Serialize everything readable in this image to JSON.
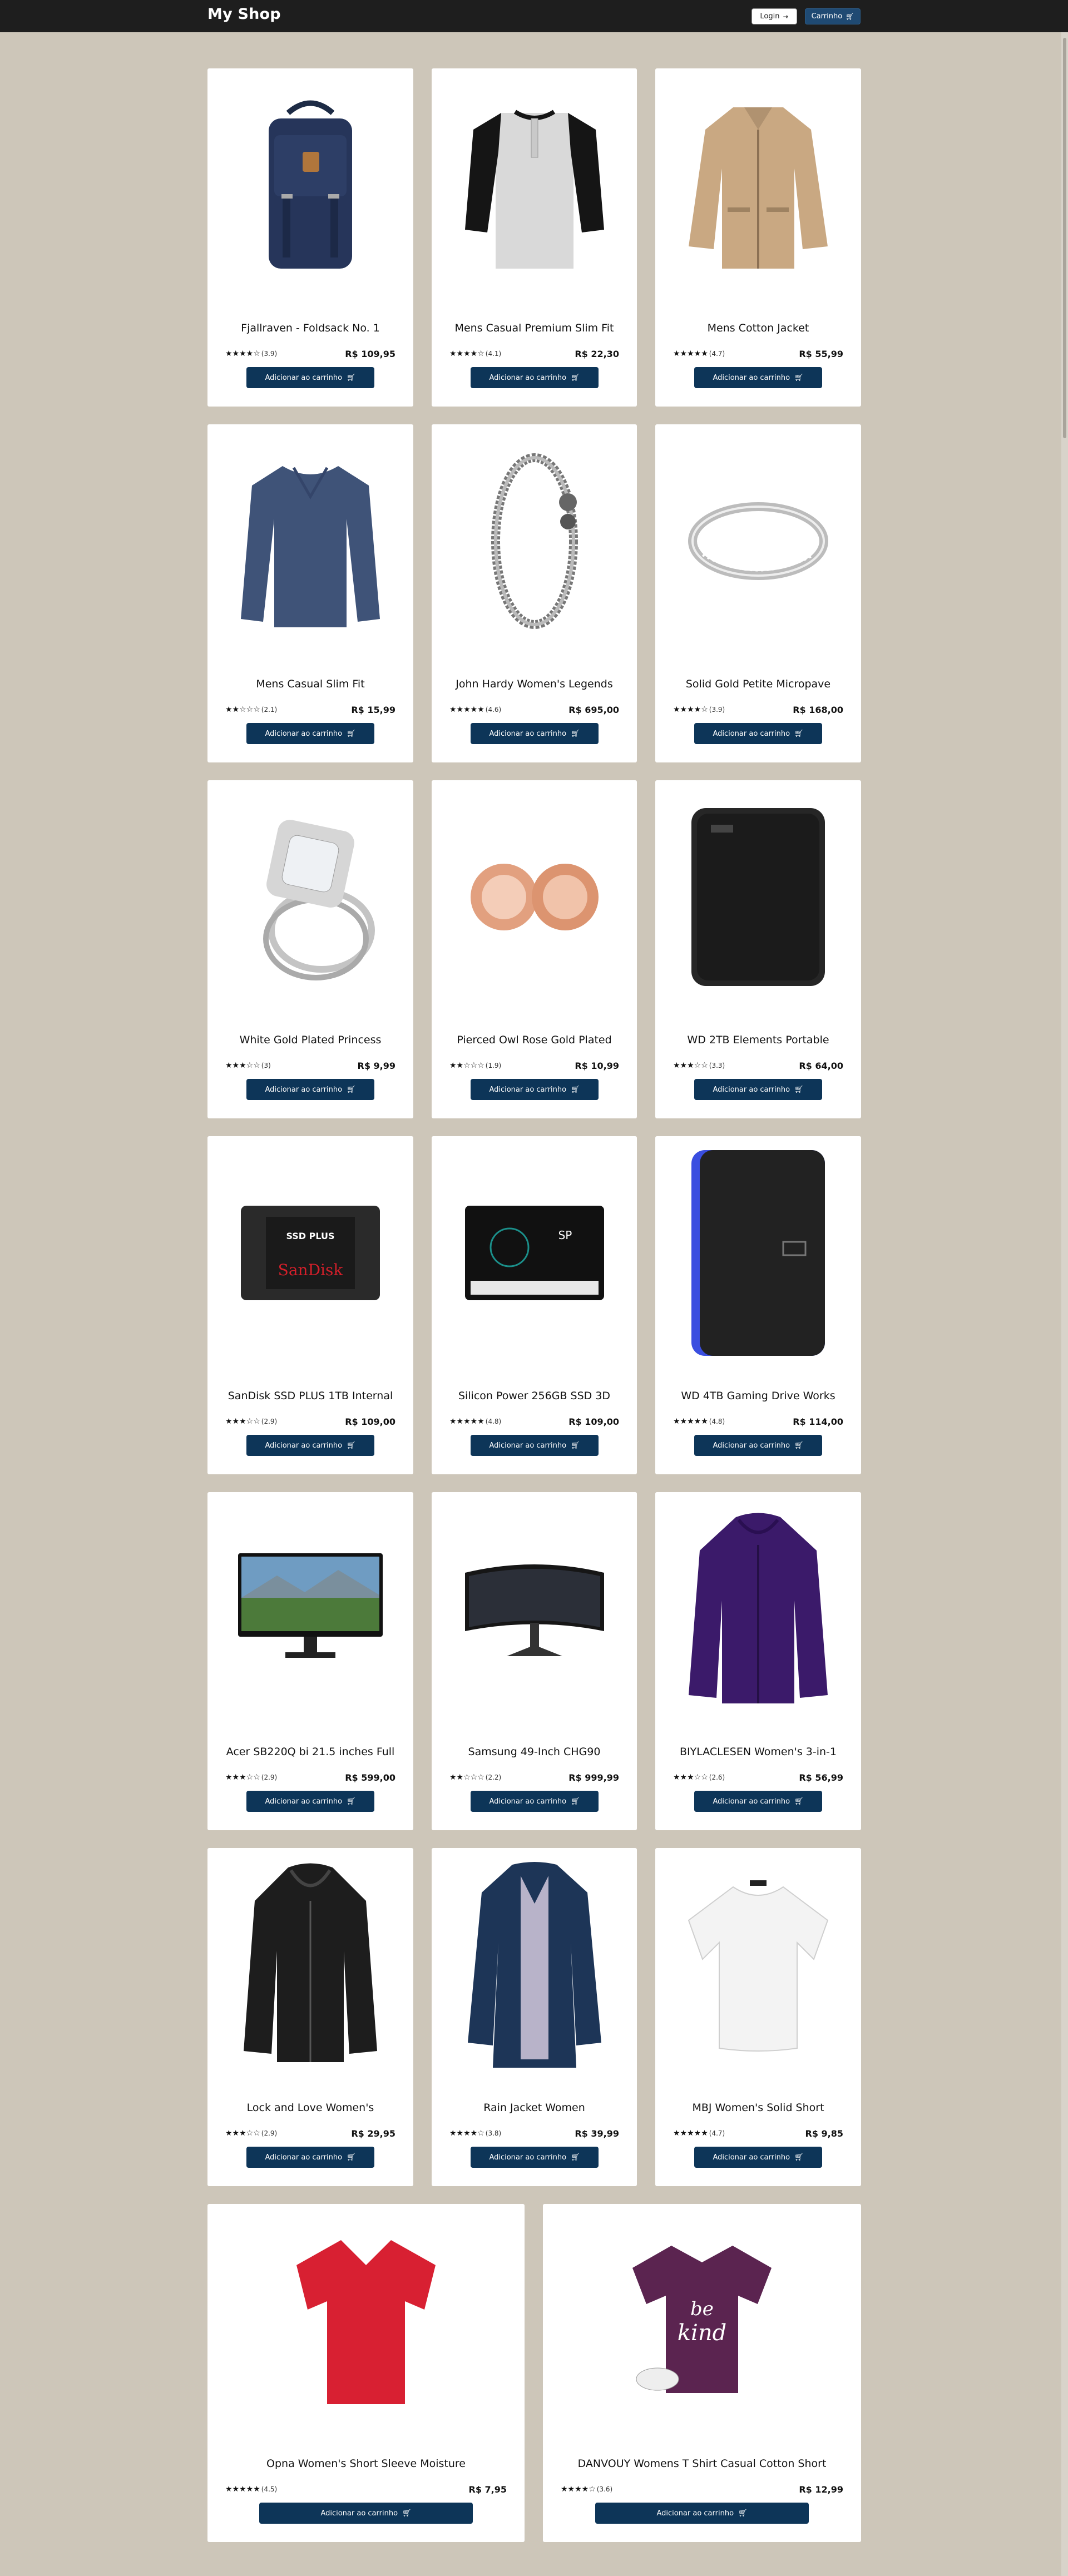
{
  "header": {
    "logo": "My Shop",
    "login_label": "Login",
    "login_icon": "login-icon",
    "cart_label": "Carrinho",
    "cart_icon": "cart-icon"
  },
  "colors": {
    "header_bg": "#1e1e1e",
    "page_bg": "#cdc6b9",
    "button_bg": "#0d3558",
    "cart_button_bg": "#1f4a73"
  },
  "add_to_cart_label": "Adicionar ao carrinho",
  "products": [
    {
      "title": "Fjallraven - Foldsack No. 1",
      "rating": 4,
      "count": "(3.9)",
      "price": "R$ 109,95",
      "icon": "backpack-image"
    },
    {
      "title": "Mens Casual Premium Slim Fit",
      "rating": 4,
      "count": "(4.1)",
      "price": "R$ 22,30",
      "icon": "henley-shirt-image"
    },
    {
      "title": "Mens Cotton Jacket",
      "rating": 5,
      "count": "(4.7)",
      "price": "R$ 55,99",
      "icon": "cotton-jacket-image"
    },
    {
      "title": "Mens Casual Slim Fit",
      "rating": 2,
      "count": "(2.1)",
      "price": "R$ 15,99",
      "icon": "long-sleeve-shirt-image"
    },
    {
      "title": "John Hardy Women's Legends",
      "rating": 5,
      "count": "(4.6)",
      "price": "R$ 695,00",
      "icon": "bracelet-image"
    },
    {
      "title": "Solid Gold Petite Micropave",
      "rating": 4,
      "count": "(3.9)",
      "price": "R$ 168,00",
      "icon": "ring-image"
    },
    {
      "title": "White Gold Plated Princess",
      "rating": 3,
      "count": "(3)",
      "price": "R$ 9,99",
      "icon": "diamond-ring-image"
    },
    {
      "title": "Pierced Owl Rose Gold Plated",
      "rating": 2,
      "count": "(1.9)",
      "price": "R$ 10,99",
      "icon": "rose-gold-plugs-image"
    },
    {
      "title": "WD 2TB Elements Portable",
      "rating": 3,
      "count": "(3.3)",
      "price": "R$ 64,00",
      "icon": "black-hard-drive-image"
    },
    {
      "title": "SanDisk SSD PLUS 1TB Internal",
      "rating": 3,
      "count": "(2.9)",
      "price": "R$ 109,00",
      "icon": "sandisk-ssd-image"
    },
    {
      "title": "Silicon Power 256GB SSD 3D",
      "rating": 5,
      "count": "(4.8)",
      "price": "R$ 109,00",
      "icon": "silicon-power-ssd-image"
    },
    {
      "title": "WD 4TB Gaming Drive Works",
      "rating": 5,
      "count": "(4.8)",
      "price": "R$ 114,00",
      "icon": "gaming-drive-image"
    },
    {
      "title": "Acer SB220Q bi 21.5 inches Full",
      "rating": 3,
      "count": "(2.9)",
      "price": "R$ 599,00",
      "icon": "monitor-image"
    },
    {
      "title": "Samsung 49-Inch CHG90",
      "rating": 2,
      "count": "(2.2)",
      "price": "R$ 999,99",
      "icon": "curved-monitor-image"
    },
    {
      "title": "BIYLACLESEN Women's 3-in-1",
      "rating": 3,
      "count": "(2.6)",
      "price": "R$ 56,99",
      "icon": "purple-jacket-image"
    },
    {
      "title": "Lock and Love Women's",
      "rating": 3,
      "count": "(2.9)",
      "price": "R$ 29,95",
      "icon": "leather-jacket-image"
    },
    {
      "title": "Rain Jacket Women",
      "rating": 4,
      "count": "(3.8)",
      "price": "R$ 39,99",
      "icon": "rain-jacket-image"
    },
    {
      "title": "MBJ Women's Solid Short",
      "rating": 5,
      "count": "(4.7)",
      "price": "R$ 9,85",
      "icon": "white-top-image"
    },
    {
      "title": "Opna Women's Short Sleeve Moisture",
      "rating": 5,
      "count": "(4.5)",
      "price": "R$ 7,95",
      "icon": "red-tshirt-image"
    },
    {
      "title": "DANVOUY Womens T Shirt Casual Cotton Short",
      "rating": 4,
      "count": "(3.6)",
      "price": "R$ 12,99",
      "icon": "purple-tshirt-image"
    }
  ]
}
